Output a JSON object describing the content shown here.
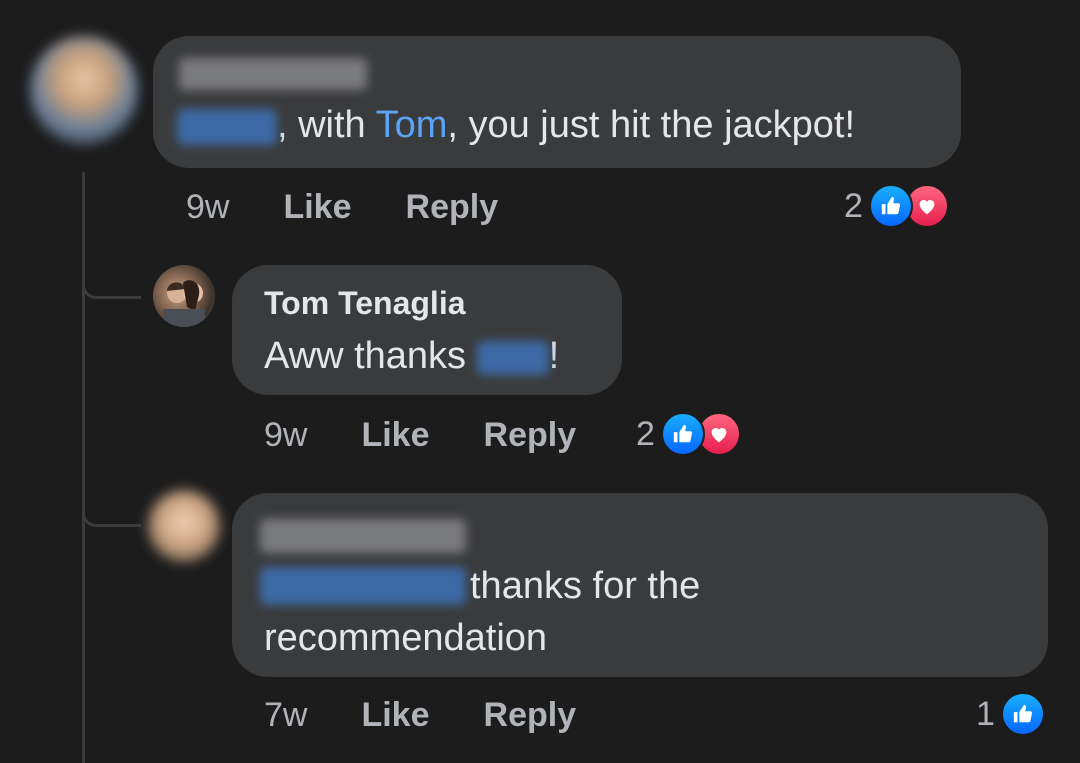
{
  "comments": [
    {
      "author": "",
      "mention_prefix": "",
      "text_after": ", with ",
      "mention_tom": "Tom",
      "text_tail": ", you just hit the jackpot!",
      "time": "9w",
      "like_label": "Like",
      "reply_label": "Reply",
      "reaction_count": "2",
      "reactions": [
        "like-icon",
        "love-icon"
      ]
    },
    {
      "author": "Tom Tenaglia",
      "text": "Aww thanks ",
      "text_end": "!",
      "time": "9w",
      "like_label": "Like",
      "reply_label": "Reply",
      "reaction_count": "2",
      "reactions": [
        "like-icon",
        "love-icon"
      ]
    },
    {
      "author": "",
      "text_line1": "thanks for the",
      "text_line2": "recommendation",
      "time": "7w",
      "like_label": "Like",
      "reply_label": "Reply",
      "reaction_count": "1",
      "reactions": [
        "like-icon"
      ]
    }
  ],
  "colors": {
    "background": "#1c1c1d",
    "bubble": "#3a3b3c",
    "text": "#e4e6eb",
    "meta": "#b0b3b8",
    "mention": "#5ba3f7",
    "like": "#0866ff",
    "love": "#e61e4d"
  }
}
